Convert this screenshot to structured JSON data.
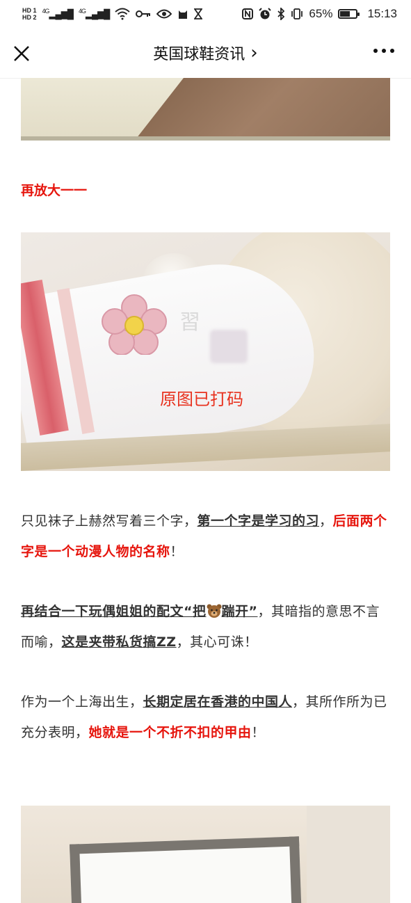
{
  "status_bar": {
    "hd1": "HD 1",
    "hd2": "HD 2",
    "net1": "4G",
    "net2": "4G",
    "battery_percent": "65%",
    "battery_level": 0.65,
    "time": "15:13"
  },
  "nav": {
    "title": "英国球鞋资讯",
    "chevron": "›"
  },
  "article": {
    "heading": "再放大一一",
    "image2_overlay": "原图已打码",
    "image2_watermark": "習",
    "p1": {
      "t1": "只见袜子上赫然写着三个字，",
      "u1": "第一个字是学习的习",
      "t2": "，",
      "r1": "后面两个字是一个动漫人物的名称",
      "t3": "！"
    },
    "p2": {
      "u1a": "再结合一下玩偶姐姐的配文“把",
      "u1b": "踹开”",
      "t1": "，其暗指的意思不言而喻，",
      "u2": "这是夹带私货搞ZZ",
      "t2": "，其心可诛！"
    },
    "p3": {
      "t1": "作为一个上海出生，",
      "u1": "长期定居在香港的中国人",
      "t2": "，其所作所为已充分表明，",
      "r1": "她就是一个不折不扣的甲由",
      "t3": "！"
    }
  },
  "colors": {
    "accent_red": "#e6150d",
    "text": "#333333"
  }
}
